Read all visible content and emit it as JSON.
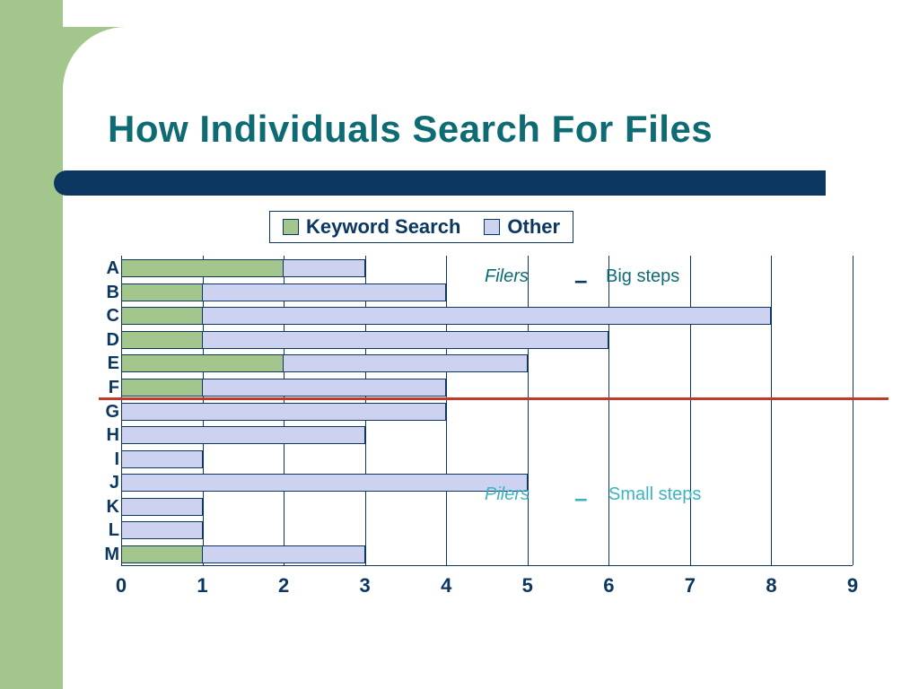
{
  "title": "How Individuals Search For Files",
  "legend": {
    "keyword": "Keyword Search",
    "other": "Other"
  },
  "annotations": {
    "filers": "Filers",
    "big": "Big steps",
    "pilers": "Pilers",
    "small": "Small steps",
    "dash": "–"
  },
  "chart_data": {
    "type": "bar",
    "orientation": "horizontal",
    "stacked": true,
    "xlabel": "",
    "ylabel": "",
    "xlim": [
      0,
      9
    ],
    "xticks": [
      0,
      1,
      2,
      3,
      4,
      5,
      6,
      7,
      8,
      9
    ],
    "categories": [
      "A",
      "B",
      "C",
      "D",
      "E",
      "F",
      "G",
      "H",
      "I",
      "J",
      "K",
      "L",
      "M"
    ],
    "series": [
      {
        "name": "Keyword Search",
        "color": "#a3c68c",
        "values": [
          2,
          1,
          1,
          1,
          2,
          1,
          0,
          0,
          0,
          0,
          0,
          0,
          1
        ]
      },
      {
        "name": "Other",
        "color": "#cdd2f1",
        "values": [
          3,
          4,
          8,
          6,
          5,
          4,
          4,
          3,
          1,
          5,
          1,
          1,
          3
        ]
      }
    ],
    "divider_after_index": 5,
    "annotations": [
      {
        "text": "Filers",
        "group": "top",
        "style": "italic"
      },
      {
        "text": "Big steps",
        "group": "top"
      },
      {
        "text": "Pilers",
        "group": "bottom",
        "style": "italic"
      },
      {
        "text": "Small steps",
        "group": "bottom"
      }
    ]
  }
}
